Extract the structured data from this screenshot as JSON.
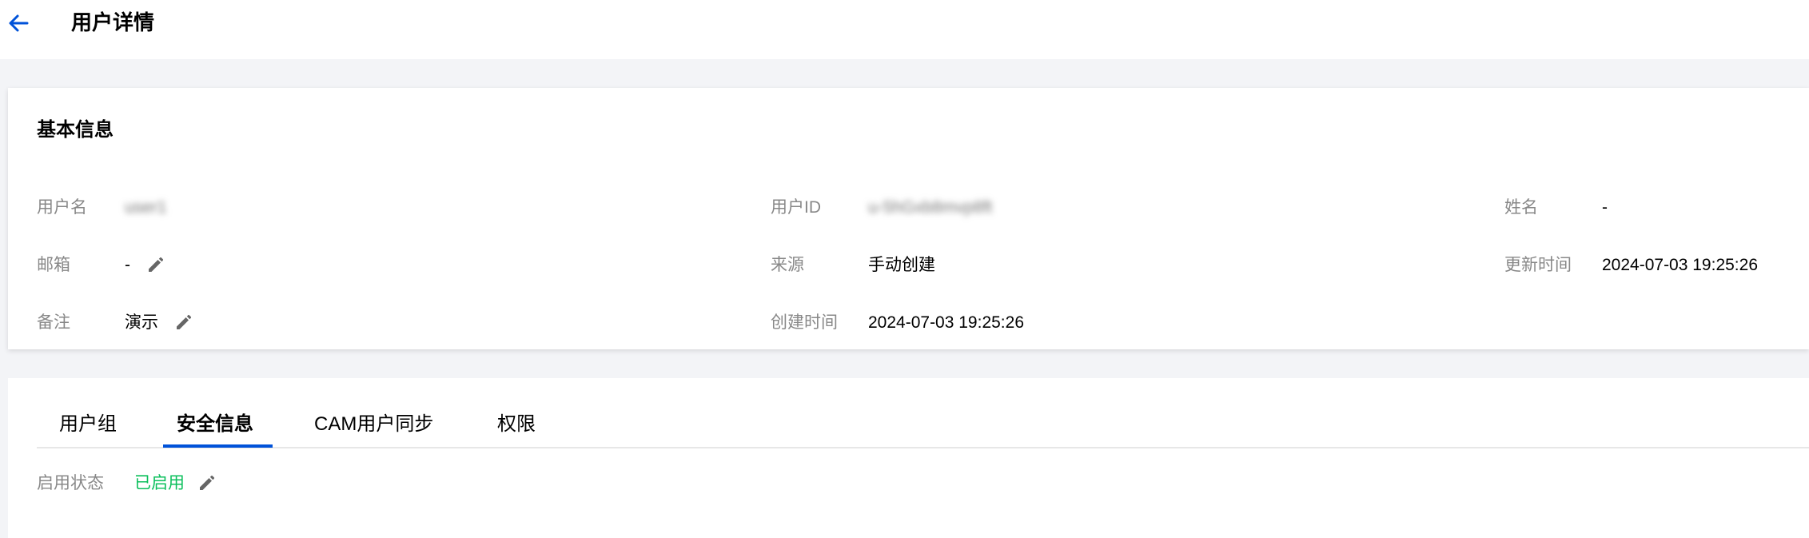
{
  "header": {
    "back_icon": "arrow-left-icon",
    "title": "用户详情",
    "accent": "#0052d9"
  },
  "basic_info": {
    "title": "基本信息",
    "username_label": "用户名",
    "username_value": "user1",
    "user_id_label": "用户ID",
    "user_id_value": "u-5hGxb8mvp8ft",
    "name_label": "姓名",
    "name_value": "-",
    "email_label": "邮箱",
    "email_value": "-",
    "source_label": "来源",
    "source_value": "手动创建",
    "updated_label": "更新时间",
    "updated_value": "2024-07-03 19:25:26",
    "remark_label": "备注",
    "remark_value": "演示",
    "created_label": "创建时间",
    "created_value": "2024-07-03 19:25:26",
    "edit_icon": "pencil-icon"
  },
  "tabs": {
    "items": [
      {
        "label": "用户组"
      },
      {
        "label": "安全信息"
      },
      {
        "label": "CAM用户同步"
      },
      {
        "label": "权限"
      }
    ],
    "active_index": 1
  },
  "security": {
    "status_label": "启用状态",
    "status_value": "已启用",
    "status_color": "#0abf5b"
  }
}
